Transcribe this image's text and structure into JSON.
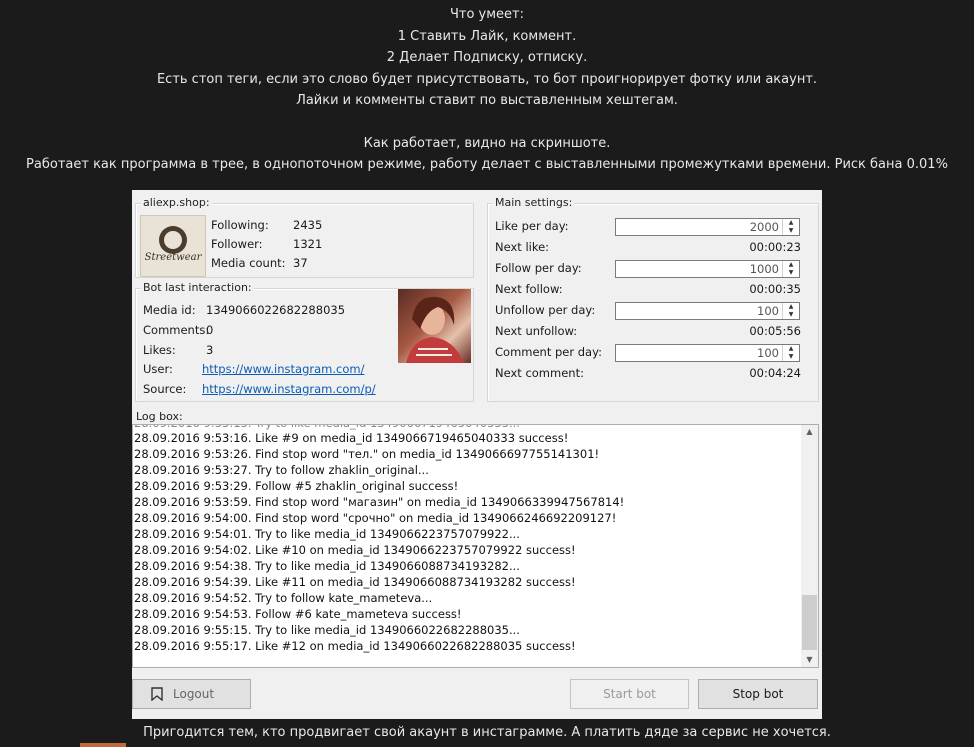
{
  "intro": {
    "lines": [
      "Что умеет:",
      "1 Ставить Лайк, коммент.",
      "2 Делает Подписку, отписку.",
      "Есть стоп теги, если это слово будет присутствовать, то бот проигнорирует фотку или акаунт.",
      "Лайки и комменты ставит по выставленным хештегам.",
      "Как работает, видно на скриншоте.",
      "Работает как программа в трее, в однопоточном режиме, работу делает с выставленными промежутками времени. Риск бана 0.01%"
    ]
  },
  "footer": "Пригодится тем, кто продвигает свой акаунт в инстаграмме. А платить дяде за сервис не хочется.",
  "account": {
    "label": "aliexp.shop:",
    "logo_text": "Streetwear",
    "following_label": "Following:",
    "following": "2435",
    "follower_label": "Follower:",
    "follower": "1321",
    "media_label": "Media count:",
    "media": "37"
  },
  "interaction": {
    "label": "Bot last interaction:",
    "media_id_label": "Media id:",
    "media_id": "1349066022682288035",
    "comments_label": "Comments:",
    "comments": "0",
    "likes_label": "Likes:",
    "likes": "3",
    "user_label": "User:",
    "user": "https://www.instagram.com/",
    "source_label": "Source:",
    "source": "https://www.instagram.com/p/"
  },
  "settings": {
    "label": "Main settings:",
    "like_per_day_label": "Like per day:",
    "like_per_day": "2000",
    "next_like_label": "Next like:",
    "next_like": "00:00:23",
    "follow_per_day_label": "Follow per day:",
    "follow_per_day": "1000",
    "next_follow_label": "Next follow:",
    "next_follow": "00:00:35",
    "unfollow_per_day_label": "Unfollow per day:",
    "unfollow_per_day": "100",
    "next_unfollow_label": "Next unfollow:",
    "next_unfollow": "00:05:56",
    "comment_per_day_label": "Comment per day:",
    "comment_per_day": "100",
    "next_comment_label": "Next comment:",
    "next_comment": "00:04:24"
  },
  "log": {
    "label": "Log box:",
    "lines": [
      "28.09.2016 9:53:16. Like #9 on media_id 1349066719465040333 success!",
      "28.09.2016 9:53:26. Find stop word \"тел.\" on media_id 1349066697755141301!",
      "28.09.2016 9:53:27. Try to follow zhaklin_original...",
      "28.09.2016 9:53:29. Follow #5 zhaklin_original success!",
      "28.09.2016 9:53:59. Find stop word \"магазин\" on media_id 1349066339947567814!",
      "28.09.2016 9:54:00. Find stop word \"срочно\" on media_id 1349066246692209127!",
      "28.09.2016 9:54:01. Try to like media_id 1349066223757079922...",
      "28.09.2016 9:54:02. Like #10 on media_id 1349066223757079922 success!",
      "28.09.2016 9:54:38. Try to like media_id 1349066088734193282...",
      "28.09.2016 9:54:39. Like #11 on media_id 1349066088734193282 success!",
      "28.09.2016 9:54:52. Try to follow kate_mameteva...",
      "28.09.2016 9:54:53. Follow #6 kate_mameteva success!",
      "28.09.2016 9:55:15. Try to like media_id 1349066022682288035...",
      "28.09.2016 9:55:17. Like #12 on media_id 1349066022682288035 success!"
    ]
  },
  "buttons": {
    "logout": "Logout",
    "start": "Start bot",
    "stop": "Stop bot"
  }
}
